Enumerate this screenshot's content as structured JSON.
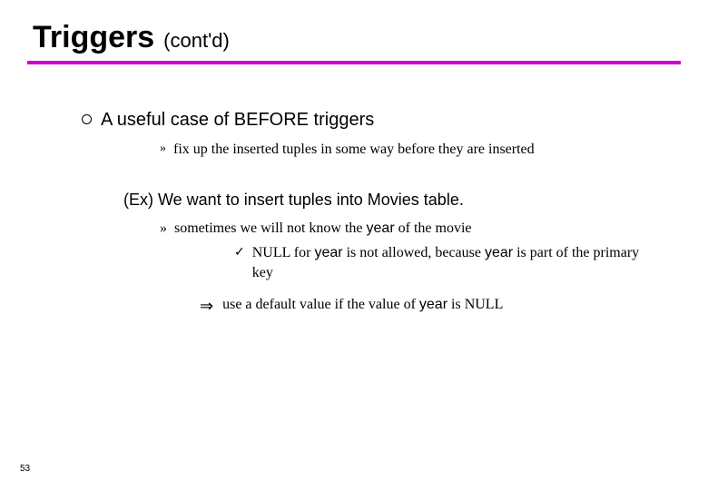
{
  "title": {
    "main": "Triggers",
    "sub": "(cont'd)"
  },
  "p1": {
    "text": "A useful case of BEFORE triggers"
  },
  "p1_sub": {
    "text": "fix up the inserted tuples in some way before they are inserted"
  },
  "ex": {
    "label": "(Ex) We want to insert tuples into Movies table."
  },
  "p2": {
    "prefix": "sometimes we will not know the ",
    "code1": "year",
    "suffix": " of the movie"
  },
  "p3": {
    "prefix": "NULL for ",
    "code1": "year",
    "mid": " is not allowed, because ",
    "code2": "year",
    "suffix": " is part of the primary key"
  },
  "p4": {
    "prefix": "use a default value if the value of ",
    "code1": "year",
    "suffix": " is NULL"
  },
  "slide_number": "53"
}
